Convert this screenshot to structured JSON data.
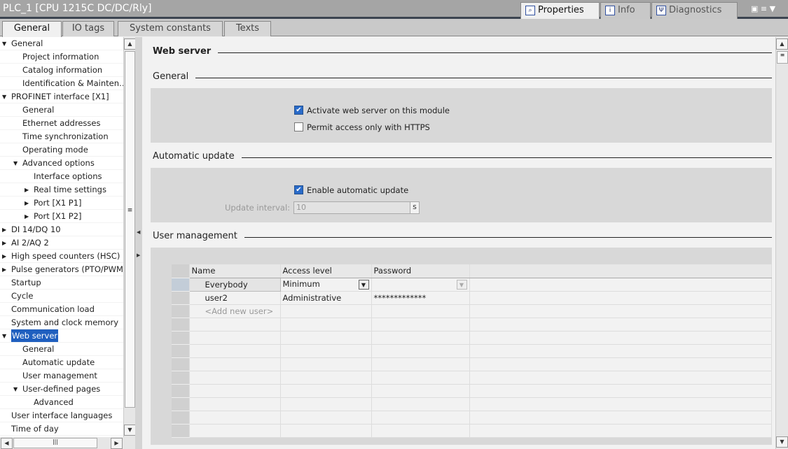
{
  "title": "PLC_1 [CPU 1215C DC/DC/Rly]",
  "panel_tabs": [
    {
      "label": "Properties",
      "icon": "properties-icon"
    },
    {
      "label": "Info",
      "icon": "info-icon"
    },
    {
      "label": "Diagnostics",
      "icon": "diagnostics-icon"
    }
  ],
  "tabs": [
    "General",
    "IO tags",
    "System constants",
    "Texts"
  ],
  "tree": [
    {
      "label": "General",
      "level": 0,
      "arrow": "down"
    },
    {
      "label": "Project information",
      "level": 1
    },
    {
      "label": "Catalog information",
      "level": 1
    },
    {
      "label": "Identification & Mainten…",
      "level": 1
    },
    {
      "label": "PROFINET interface [X1]",
      "level": 0,
      "arrow": "down"
    },
    {
      "label": "General",
      "level": 1
    },
    {
      "label": "Ethernet addresses",
      "level": 1
    },
    {
      "label": "Time synchronization",
      "level": 1
    },
    {
      "label": "Operating mode",
      "level": 1
    },
    {
      "label": "Advanced options",
      "level": 1,
      "arrow": "down"
    },
    {
      "label": "Interface options",
      "level": 2
    },
    {
      "label": "Real time settings",
      "level": 2,
      "arrow": "right"
    },
    {
      "label": "Port [X1 P1]",
      "level": 2,
      "arrow": "right"
    },
    {
      "label": "Port [X1 P2]",
      "level": 2,
      "arrow": "right"
    },
    {
      "label": "DI 14/DQ 10",
      "level": 0,
      "arrow": "right"
    },
    {
      "label": "AI 2/AQ 2",
      "level": 0,
      "arrow": "right"
    },
    {
      "label": "High speed counters (HSC)",
      "level": 0,
      "arrow": "right"
    },
    {
      "label": "Pulse generators (PTO/PWM)",
      "level": 0,
      "arrow": "right"
    },
    {
      "label": "Startup",
      "level": 0
    },
    {
      "label": "Cycle",
      "level": 0
    },
    {
      "label": "Communication load",
      "level": 0
    },
    {
      "label": "System and clock memory",
      "level": 0
    },
    {
      "label": "Web server",
      "level": 0,
      "arrow": "down",
      "selected": true
    },
    {
      "label": "General",
      "level": 1
    },
    {
      "label": "Automatic update",
      "level": 1
    },
    {
      "label": "User management",
      "level": 1
    },
    {
      "label": "User-defined pages",
      "level": 1,
      "arrow": "down"
    },
    {
      "label": "Advanced",
      "level": 2
    },
    {
      "label": "User interface languages",
      "level": 0
    },
    {
      "label": "Time of day",
      "level": 0
    }
  ],
  "content": {
    "heading": "Web server",
    "general": {
      "title": "General",
      "activate": {
        "label": "Activate web server on this module",
        "checked": true
      },
      "https": {
        "label": "Permit access only with HTTPS",
        "checked": false
      }
    },
    "auto_update": {
      "title": "Automatic update",
      "enable": {
        "label": "Enable automatic update",
        "checked": true
      },
      "interval_label": "Update interval:",
      "interval_value": "10",
      "interval_unit": "s"
    },
    "users": {
      "title": "User management",
      "columns": [
        "Name",
        "Access level",
        "Password"
      ],
      "rows": [
        {
          "name": "Everybody",
          "access": "Minimum",
          "password": ""
        },
        {
          "name": "user2",
          "access": "Administrative",
          "password": "*************"
        }
      ],
      "add_placeholder": "<Add new user>"
    }
  },
  "colors": {
    "selected": "#1f5fbf",
    "checkbox": "#2a6bc9"
  }
}
